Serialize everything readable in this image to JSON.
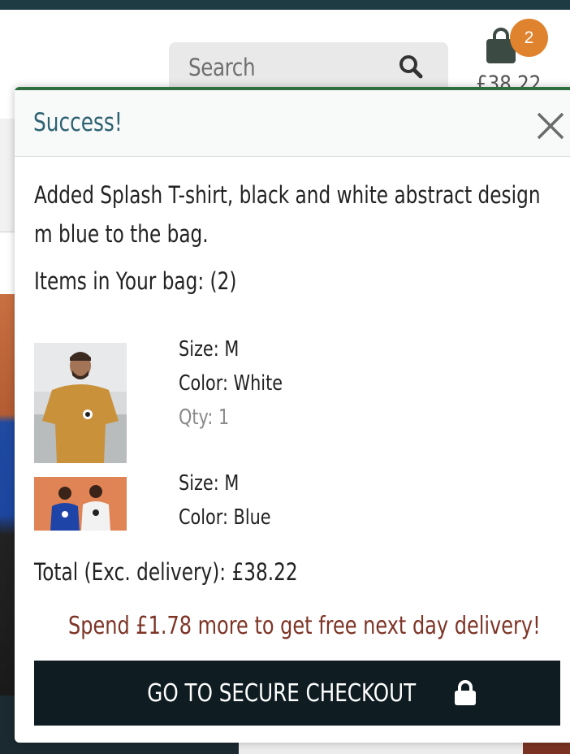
{
  "header": {
    "search": {
      "placeholder": "Search"
    },
    "bag": {
      "count": "2",
      "total": "£38.22"
    }
  },
  "toast": {
    "title": "Success!",
    "message_line1": "Added Splash T-shirt, black and white abstract design",
    "message_line2": "m blue to the bag.",
    "items_count": "Items in Your bag: (2)",
    "items": [
      {
        "size": "Size: M",
        "color": "Color: White",
        "qty": "Qty: 1"
      },
      {
        "size": "Size: M",
        "color": "Color: Blue"
      }
    ],
    "total": "Total (Exc. delivery): £38.22",
    "free_delivery": "Spend £1.78 more to get free next day delivery!",
    "checkout_label": "GO TO SECURE CHECKOUT"
  },
  "colors": {
    "header_strip": "#1e3b44",
    "badge": "#e0832f",
    "toast_title": "#2d6272",
    "toast_border": "#2f6f3f",
    "delivery_text": "#7d3426",
    "checkout_bg": "#0f1c22"
  },
  "icons": [
    "search-icon",
    "shopping-bag-icon",
    "close-icon",
    "lock-icon"
  ]
}
